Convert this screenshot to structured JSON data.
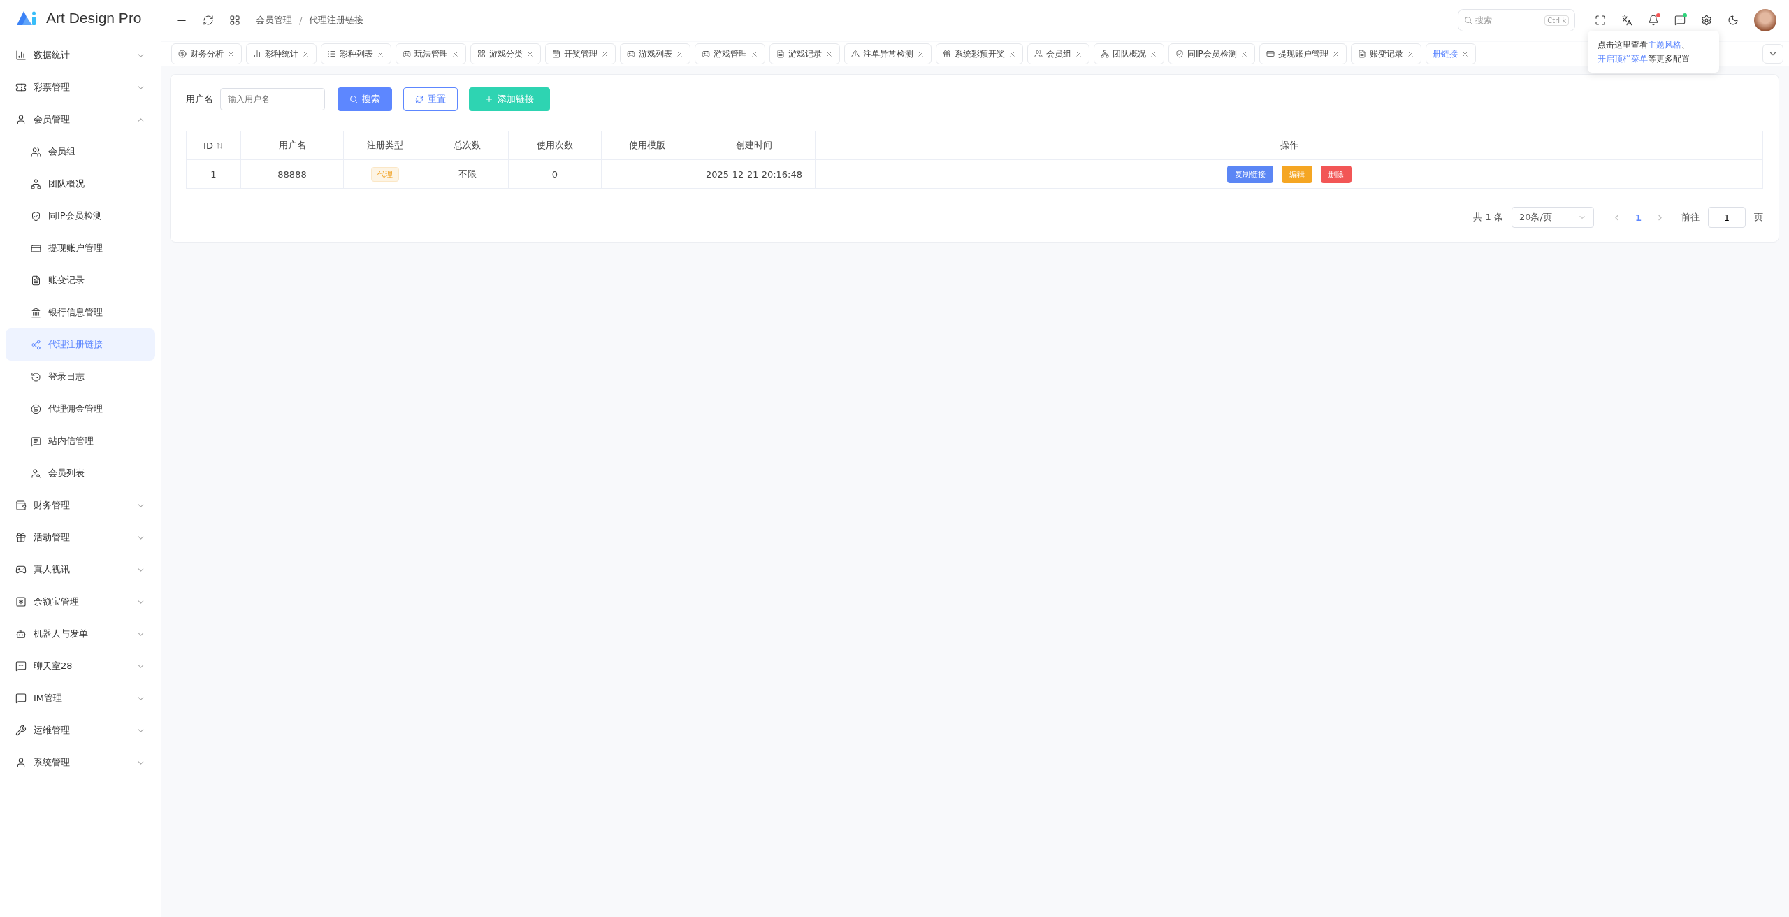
{
  "sidebar": {
    "logo": "Art Design Pro",
    "items": [
      {
        "label": "数据统计",
        "expanded": false
      },
      {
        "label": "彩票管理",
        "expanded": false
      },
      {
        "label": "会员管理",
        "expanded": true,
        "children": [
          {
            "label": "会员组",
            "selected": false
          },
          {
            "label": "团队概况",
            "selected": false
          },
          {
            "label": "同IP会员检测",
            "selected": false
          },
          {
            "label": "提现账户管理",
            "selected": false
          },
          {
            "label": "账变记录",
            "selected": false
          },
          {
            "label": "银行信息管理",
            "selected": false
          },
          {
            "label": "代理注册链接",
            "selected": true
          },
          {
            "label": "登录日志",
            "selected": false
          },
          {
            "label": "代理佣金管理",
            "selected": false
          },
          {
            "label": "站内信管理",
            "selected": false
          },
          {
            "label": "会员列表",
            "selected": false
          }
        ]
      },
      {
        "label": "财务管理",
        "expanded": false
      },
      {
        "label": "活动管理",
        "expanded": false
      },
      {
        "label": "真人视讯",
        "expanded": false
      },
      {
        "label": "余额宝管理",
        "expanded": false
      },
      {
        "label": "机器人与发单",
        "expanded": false
      },
      {
        "label": "聊天室28",
        "expanded": false
      },
      {
        "label": "IM管理",
        "expanded": false
      },
      {
        "label": "运维管理",
        "expanded": false
      },
      {
        "label": "系统管理",
        "expanded": false
      }
    ]
  },
  "header": {
    "breadcrumb": [
      "会员管理",
      "代理注册链接"
    ],
    "breadcrumb_separator": "/",
    "search": {
      "placeholder": "搜索",
      "shortcut": "Ctrl k"
    },
    "notifications_unread": true,
    "chat_unread": true
  },
  "tabs": [
    {
      "label": "财务分析",
      "selected": false
    },
    {
      "label": "彩种统计",
      "selected": false
    },
    {
      "label": "彩种列表",
      "selected": false
    },
    {
      "label": "玩法管理",
      "selected": false
    },
    {
      "label": "游戏分类",
      "selected": false
    },
    {
      "label": "开奖管理",
      "selected": false
    },
    {
      "label": "游戏列表",
      "selected": false
    },
    {
      "label": "游戏管理",
      "selected": false
    },
    {
      "label": "游戏记录",
      "selected": false
    },
    {
      "label": "注单异常检测",
      "selected": false
    },
    {
      "label": "系统彩预开奖",
      "selected": false
    },
    {
      "label": "会员组",
      "selected": false
    },
    {
      "label": "团队概况",
      "selected": false
    },
    {
      "label": "同IP会员检测",
      "selected": false
    },
    {
      "label": "提现账户管理",
      "selected": false
    },
    {
      "label": "账变记录",
      "selected": false
    },
    {
      "label": "册链接",
      "selected": true
    }
  ],
  "tooltip": {
    "before": "点击这里查看",
    "link_1": "主题风格",
    "middle": "、",
    "link_2": "开启顶栏菜单",
    "after": "等更多配置"
  },
  "filter": {
    "label": "用户名",
    "placeholder": "输入用户名",
    "buttons": [
      {
        "label": "搜索",
        "kind": "primary"
      },
      {
        "label": "重置",
        "kind": "outline"
      },
      {
        "label": "添加链接",
        "kind": "add"
      }
    ]
  },
  "table": {
    "columns": [
      {
        "label": "ID",
        "sortable": true
      },
      {
        "label": "用户名",
        "sortable": false
      },
      {
        "label": "注册类型",
        "sortable": false
      },
      {
        "label": "总次数",
        "sortable": false
      },
      {
        "label": "使用次数",
        "sortable": false
      },
      {
        "label": "使用模版",
        "sortable": false
      },
      {
        "label": "创建时间",
        "sortable": false
      },
      {
        "label": "操作",
        "sortable": false
      }
    ],
    "rows": [
      {
        "id": "1",
        "username": "88888",
        "type": "代理",
        "total": "不限",
        "used": "0",
        "created": "2025-12-21 20:16:48",
        "actions": [
          {
            "label": "复制链接",
            "color": "#5b86f5"
          },
          {
            "label": "编辑",
            "color": "#f5a623"
          },
          {
            "label": "删除",
            "color": "#f25656"
          }
        ]
      }
    ]
  },
  "pagination": {
    "total": "共 1 条",
    "page_size": "20条/页",
    "pages": [
      {
        "label": "1",
        "selected": true
      }
    ],
    "goto_label": "前往",
    "goto_value": "1",
    "goto_suffix": "页"
  }
}
